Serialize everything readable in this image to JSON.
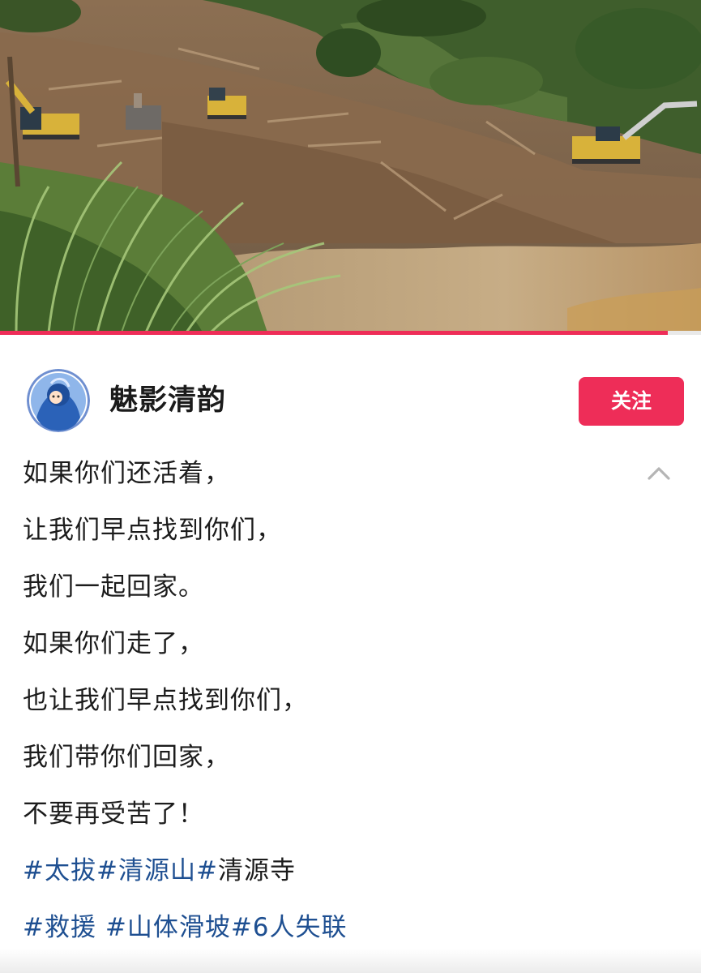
{
  "video": {
    "description_icon": "landslide-video-frame",
    "progress": 0.953
  },
  "author": {
    "name": "魅影清韵",
    "avatar_icon": "cartoon-avatar-icon"
  },
  "follow_button": {
    "label": "关注",
    "color": "#ee2d58"
  },
  "collapse_icon": "chevron-up-icon",
  "caption": {
    "lines": [
      "如果你们还活着，",
      "让我们早点找到你们，",
      "我们一起回家。",
      "如果你们走了，",
      "也让我们早点找到你们，",
      "我们带你们回家，",
      "不要再受苦了！"
    ],
    "tag_lines": [
      [
        {
          "text": "#太拔",
          "link": true
        },
        {
          "text": "#清源山",
          "link": true
        },
        {
          "text": "#",
          "link": true
        },
        {
          "text": "清源寺",
          "link": false
        }
      ],
      [
        {
          "text": "#救援",
          "link": true
        },
        {
          "text": " ",
          "link": false
        },
        {
          "text": "#山体滑坡",
          "link": true
        },
        {
          "text": "#6人失联",
          "link": true
        }
      ]
    ]
  },
  "colors": {
    "accent": "#ee2d58",
    "hashtag": "#1e4f91",
    "text": "#1c1c1c"
  }
}
